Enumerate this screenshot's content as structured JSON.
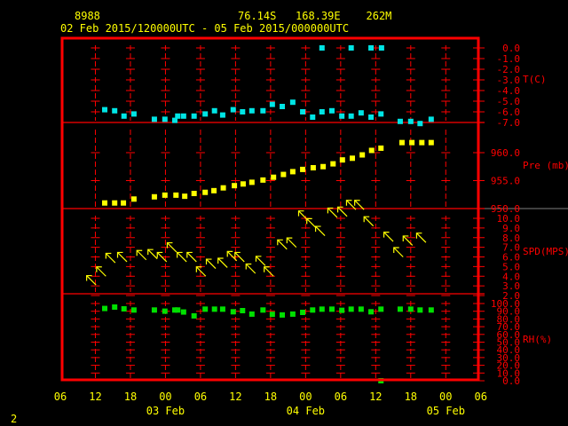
{
  "header": {
    "station_id": "8988",
    "location": "76.14S   168.39E    262M",
    "period": "02 Feb 2015/120000UTC - 05 Feb 2015/000000UTC"
  },
  "footer": {
    "page_number": "2"
  },
  "colors": {
    "frame": "#ff0000",
    "text": "#ffff00",
    "temperature": "#00e5e5",
    "pressure": "#ffff00",
    "wind": "#ffff00",
    "rh": "#00e000",
    "separator_gray": "#808080"
  },
  "chart_data": {
    "type": "scatter",
    "title": "8988  76.14S 168.39E 262M",
    "x_units": "hours since 02 Feb 2015 06UTC",
    "x_range": [
      0,
      72
    ],
    "x_ticks": [
      {
        "h": 0,
        "label": "06"
      },
      {
        "h": 6,
        "label": "12"
      },
      {
        "h": 12,
        "label": "18"
      },
      {
        "h": 18,
        "label": "00"
      },
      {
        "h": 24,
        "label": "06"
      },
      {
        "h": 30,
        "label": "12"
      },
      {
        "h": 36,
        "label": "18"
      },
      {
        "h": 42,
        "label": "00"
      },
      {
        "h": 48,
        "label": "06"
      },
      {
        "h": 54,
        "label": "12"
      },
      {
        "h": 60,
        "label": "18"
      },
      {
        "h": 66,
        "label": "00"
      },
      {
        "h": 72,
        "label": "06"
      }
    ],
    "date_labels": [
      {
        "h": 18,
        "label": "03 Feb"
      },
      {
        "h": 42,
        "label": "04 Feb"
      },
      {
        "h": 66,
        "label": "05 Feb"
      }
    ],
    "panels": [
      {
        "name": "temperature",
        "ylabel": "T(C)",
        "ylim": [
          -7,
          0
        ],
        "ticks": [
          "0.0",
          "-1.0",
          "-2.0",
          "-3.0",
          "-4.0",
          "-5.0",
          "-6.0",
          "-7.0"
        ],
        "points": [
          [
            7.6,
            -5.8
          ],
          [
            9.3,
            -5.9
          ],
          [
            10.9,
            -6.4
          ],
          [
            12.6,
            -6.2
          ],
          [
            16.1,
            -6.7
          ],
          [
            17.9,
            -6.7
          ],
          [
            19.6,
            -6.8
          ],
          [
            20.1,
            -6.4
          ],
          [
            21.1,
            -6.4
          ],
          [
            22.9,
            -6.4
          ],
          [
            24.8,
            -6.2
          ],
          [
            26.4,
            -5.9
          ],
          [
            27.8,
            -6.3
          ],
          [
            29.6,
            -5.8
          ],
          [
            31.2,
            -6.0
          ],
          [
            32.8,
            -5.9
          ],
          [
            34.7,
            -5.9
          ],
          [
            36.3,
            -5.3
          ],
          [
            38.0,
            -5.5
          ],
          [
            39.8,
            -5.1
          ],
          [
            41.5,
            -6.0
          ],
          [
            43.2,
            -6.5
          ],
          [
            44.8,
            -6.0
          ],
          [
            46.5,
            -5.9
          ],
          [
            48.2,
            -6.4
          ],
          [
            49.8,
            -6.4
          ],
          [
            51.5,
            -6.1
          ],
          [
            53.2,
            -6.5
          ],
          [
            54.9,
            -6.2
          ],
          [
            58.2,
            -6.9
          ],
          [
            60.0,
            -6.9
          ],
          [
            61.6,
            -7.1
          ],
          [
            63.5,
            -6.7
          ],
          [
            44.8,
            0.0
          ],
          [
            49.8,
            0.0
          ],
          [
            53.2,
            0.0
          ],
          [
            55.0,
            0.0
          ]
        ]
      },
      {
        "name": "pressure",
        "ylabel": "Pre (mb)",
        "ylim": [
          950,
          960
        ],
        "ticks": [
          "960.0",
          "955.0",
          "950.0"
        ],
        "points": [
          [
            7.6,
            951.0
          ],
          [
            9.3,
            951.0
          ],
          [
            10.8,
            951.0
          ],
          [
            12.6,
            951.7
          ],
          [
            16.1,
            952.1
          ],
          [
            17.9,
            952.4
          ],
          [
            19.8,
            952.4
          ],
          [
            21.3,
            952.2
          ],
          [
            22.9,
            952.7
          ],
          [
            24.8,
            952.9
          ],
          [
            26.3,
            953.2
          ],
          [
            27.9,
            953.7
          ],
          [
            29.8,
            954.1
          ],
          [
            31.3,
            954.4
          ],
          [
            32.8,
            954.7
          ],
          [
            34.7,
            955.1
          ],
          [
            36.5,
            955.6
          ],
          [
            38.2,
            956.1
          ],
          [
            39.8,
            956.6
          ],
          [
            41.5,
            957.0
          ],
          [
            43.3,
            957.3
          ],
          [
            45.0,
            957.5
          ],
          [
            46.7,
            958.0
          ],
          [
            48.3,
            958.7
          ],
          [
            50.0,
            959.0
          ],
          [
            51.7,
            959.6
          ],
          [
            53.3,
            960.4
          ],
          [
            54.9,
            960.8
          ],
          [
            58.5,
            961.8
          ],
          [
            60.2,
            961.8
          ],
          [
            61.9,
            961.8
          ],
          [
            63.5,
            961.8
          ]
        ]
      },
      {
        "name": "wind_speed",
        "ylabel": "SPD(MPS)",
        "ylim": [
          2,
          10
        ],
        "ticks": [
          "10.0",
          "9.0",
          "8.0",
          "7.0",
          "6.0",
          "5.0",
          "4.0",
          "3.0",
          "2.0"
        ],
        "points": [
          [
            6.1,
            3.1
          ],
          [
            7.8,
            4.0
          ],
          [
            9.4,
            5.4
          ],
          [
            11.4,
            5.5
          ],
          [
            14.7,
            5.7
          ],
          [
            16.6,
            5.8
          ],
          [
            18.2,
            5.5
          ],
          [
            19.9,
            6.5
          ],
          [
            21.6,
            5.5
          ],
          [
            23.3,
            5.5
          ],
          [
            24.9,
            4.0
          ],
          [
            26.6,
            4.8
          ],
          [
            28.6,
            4.9
          ],
          [
            30.2,
            5.6
          ],
          [
            31.5,
            5.5
          ],
          [
            33.4,
            4.3
          ],
          [
            35.1,
            5.1
          ],
          [
            36.5,
            4.0
          ],
          [
            38.8,
            6.8
          ],
          [
            40.4,
            7.0
          ],
          [
            42.4,
            9.8
          ],
          [
            43.8,
            9.0
          ],
          [
            45.3,
            8.2
          ],
          [
            47.4,
            10.1
          ],
          [
            49.1,
            10.2
          ],
          [
            50.6,
            10.9
          ],
          [
            52.0,
            10.9
          ],
          [
            53.6,
            9.2
          ],
          [
            57.0,
            7.6
          ],
          [
            58.7,
            6.0
          ],
          [
            60.3,
            7.2
          ],
          [
            62.6,
            7.5
          ]
        ],
        "arrow_direction_deg": 135
      },
      {
        "name": "relative_humidity",
        "ylabel": "RH(%)",
        "ylim": [
          0,
          100
        ],
        "ticks": [
          "100.0",
          "90.0",
          "80.0",
          "70.0",
          "60.0",
          "50.0",
          "40.0",
          "30.0",
          "20.0",
          "10.0",
          "0.0"
        ],
        "points": [
          [
            7.6,
            93.6
          ],
          [
            9.3,
            95.4
          ],
          [
            10.9,
            93.1
          ],
          [
            12.6,
            91.6
          ],
          [
            16.1,
            91.6
          ],
          [
            17.9,
            90.1
          ],
          [
            19.6,
            91.6
          ],
          [
            20.1,
            91.6
          ],
          [
            21.1,
            89.0
          ],
          [
            22.9,
            84.0
          ],
          [
            24.8,
            92.7
          ],
          [
            26.4,
            92.7
          ],
          [
            27.8,
            92.7
          ],
          [
            29.6,
            89.3
          ],
          [
            31.2,
            90.8
          ],
          [
            32.8,
            86.3
          ],
          [
            34.7,
            91.6
          ],
          [
            36.3,
            86.0
          ],
          [
            38.0,
            85.2
          ],
          [
            39.8,
            86.3
          ],
          [
            41.5,
            88.5
          ],
          [
            43.2,
            91.6
          ],
          [
            44.8,
            92.7
          ],
          [
            46.5,
            92.7
          ],
          [
            48.2,
            91.2
          ],
          [
            49.8,
            92.7
          ],
          [
            51.5,
            92.7
          ],
          [
            53.2,
            89.3
          ],
          [
            54.9,
            92.7
          ],
          [
            54.9,
            0.0
          ],
          [
            58.2,
            92.7
          ],
          [
            60.0,
            92.7
          ],
          [
            61.6,
            91.6
          ],
          [
            63.5,
            91.6
          ]
        ]
      }
    ]
  }
}
